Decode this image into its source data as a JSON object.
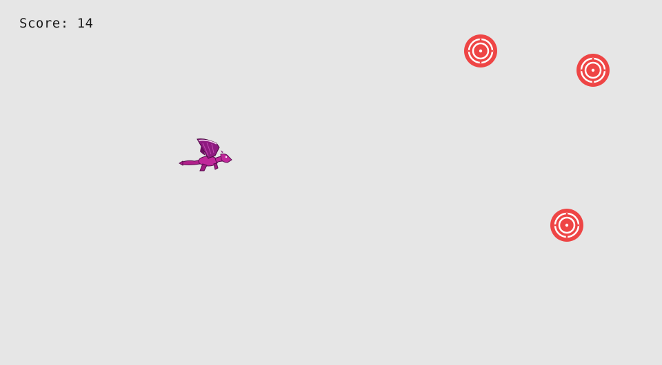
{
  "hud": {
    "score_text": "Score: 14"
  },
  "sprites": {
    "player": "dragon-icon",
    "targets": [
      "target-icon",
      "target-icon",
      "target-icon"
    ]
  },
  "colors": {
    "background": "#e6e6e6",
    "target_red": "#ee4545",
    "dragon_purple": "#b0208a",
    "dragon_wing": "#7a1870"
  }
}
